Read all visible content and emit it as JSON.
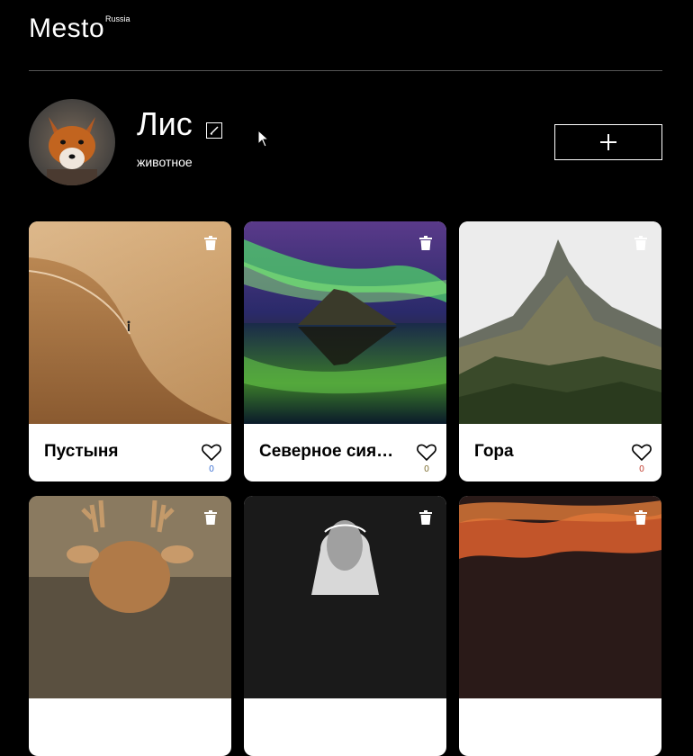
{
  "header": {
    "logo": "Mesto",
    "logo_sub": "Russia"
  },
  "profile": {
    "name": "Лис",
    "about": "животное",
    "add_label": "+"
  },
  "cards": [
    {
      "title": "Пустыня",
      "likes": "0",
      "count_color": "#3b6fd1"
    },
    {
      "title": "Северное сияние",
      "likes": "0",
      "count_color": "#7a6a2a"
    },
    {
      "title": "Гора",
      "likes": "0",
      "count_color": "#c0392b"
    },
    {
      "title": "",
      "likes": ""
    },
    {
      "title": "",
      "likes": ""
    },
    {
      "title": "",
      "likes": ""
    }
  ]
}
